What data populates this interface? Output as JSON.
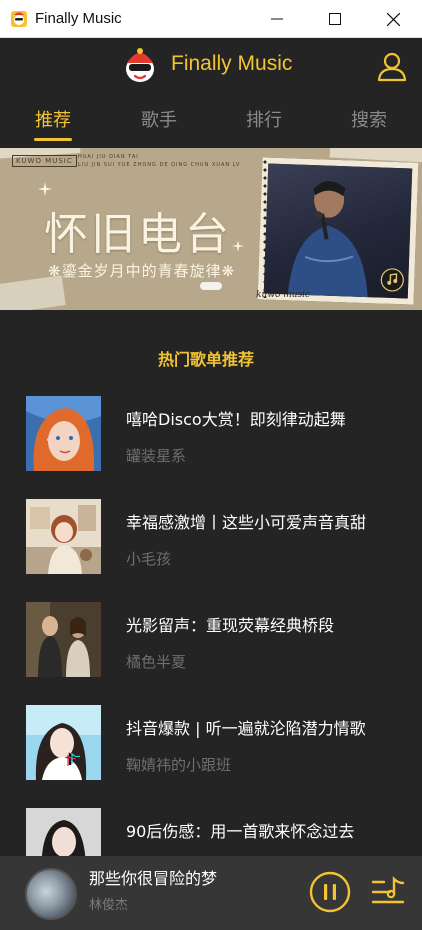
{
  "window": {
    "title": "Finally Music"
  },
  "header": {
    "brand": "Finally Music"
  },
  "tabs": [
    {
      "label": "推荐",
      "active": true
    },
    {
      "label": "歌手",
      "active": false
    },
    {
      "label": "排行",
      "active": false
    },
    {
      "label": "搜索",
      "active": false
    }
  ],
  "banner": {
    "brand_tag": "KUWO MUSIC",
    "pinyin_line1": "HUAI JIU DIAN TAI",
    "pinyin_line2": "LIU JIN SUI YUE ZHONG DE QING CHUN XUAN LV",
    "title": "怀旧电台",
    "subtitle": "❋鎏金岁月中的青春旋律❋",
    "signature": "kuwo music"
  },
  "section": {
    "title": "热门歌单推荐"
  },
  "playlists": [
    {
      "title": "嘻哈Disco大赏！即刻律动起舞",
      "creator": "罐装星系"
    },
    {
      "title": "幸福感激增丨这些小可爱声音真甜",
      "creator": "小毛孩"
    },
    {
      "title": "光影留声：重现荧幕经典桥段",
      "creator": "橘色半夏"
    },
    {
      "title": "抖音爆款 | 听一遍就沦陷潜力情歌",
      "creator": "鞠婧祎的小跟班"
    },
    {
      "title": "90后伤感：用一首歌来怀念过去",
      "creator": ""
    }
  ],
  "player": {
    "song": "那些你很冒险的梦",
    "artist": "林俊杰"
  },
  "colors": {
    "accent": "#f2c334",
    "background": "#242424",
    "player_bar": "#363636"
  }
}
